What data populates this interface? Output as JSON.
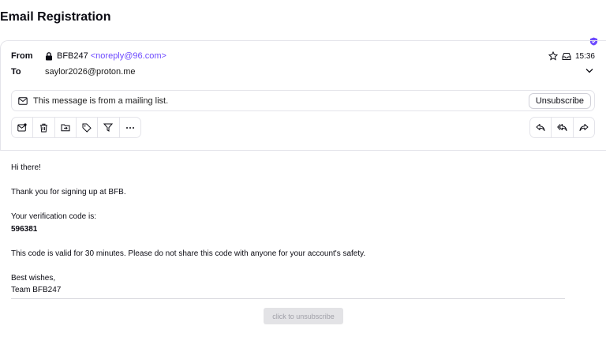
{
  "subject": "Email Registration",
  "header": {
    "from_label": "From",
    "to_label": "To",
    "sender_name": "BFB247",
    "sender_email": "<noreply@96.com>",
    "recipient": "saylor2026@proton.me",
    "time": "15:36"
  },
  "banner": {
    "text": "This message is from a mailing list.",
    "unsubscribe_label": "Unsubscribe"
  },
  "toolbar_left_icons": [
    "mark-unread-icon",
    "trash-icon",
    "move-folder-icon",
    "label-tag-icon",
    "filter-icon",
    "more-icon"
  ],
  "toolbar_right_icons": [
    "reply-icon",
    "reply-all-icon",
    "forward-icon"
  ],
  "body": {
    "greeting": "Hi there!",
    "line1": "Thank you for signing up at BFB.",
    "line2": "Your verification code is:",
    "code": "596381",
    "line3": "This code is valid for 30 minutes. Please do not share this code with anyone for your account's safety.",
    "closing": "Best wishes,",
    "signature": "Team BFB247"
  },
  "footer": {
    "unsubscribe_link": "click to unsubscribe"
  },
  "colors": {
    "accent": "#6d4aff",
    "border": "#e4e4ea"
  }
}
